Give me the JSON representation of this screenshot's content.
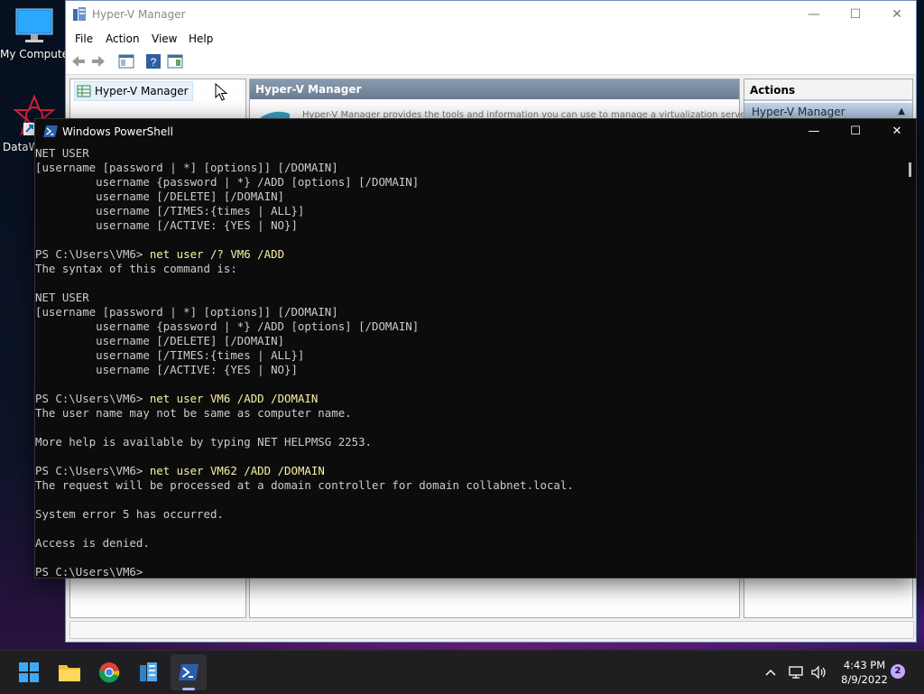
{
  "desktop": {
    "icons": [
      {
        "label": "My Computer"
      },
      {
        "label": "DataW"
      }
    ]
  },
  "hyperv": {
    "title": "Hyper-V Manager",
    "menu": [
      "File",
      "Action",
      "View",
      "Help"
    ],
    "tree_item": "Hyper-V Manager",
    "center_header": "Hyper-V Manager",
    "center_blurb": "Hyper-V Manager provides the tools and information you can use to manage a virtualization server.",
    "actions_header": "Actions",
    "actions_item": "Hyper-V Manager"
  },
  "powershell": {
    "title": "Windows PowerShell",
    "lines": [
      {
        "text": "NET USER"
      },
      {
        "text": "[username [password | *] [options]] [/DOMAIN]"
      },
      {
        "text": "         username {password | *} /ADD [options] [/DOMAIN]"
      },
      {
        "text": "         username [/DELETE] [/DOMAIN]"
      },
      {
        "text": "         username [/TIMES:{times | ALL}]"
      },
      {
        "text": "         username [/ACTIVE: {YES | NO}]"
      },
      {
        "text": ""
      },
      {
        "prompt": "PS C:\\Users\\VM6> ",
        "cmd": "net user /? VM6 /ADD"
      },
      {
        "text": "The syntax of this command is:"
      },
      {
        "text": ""
      },
      {
        "text": "NET USER"
      },
      {
        "text": "[username [password | *] [options]] [/DOMAIN]"
      },
      {
        "text": "         username {password | *} /ADD [options] [/DOMAIN]"
      },
      {
        "text": "         username [/DELETE] [/DOMAIN]"
      },
      {
        "text": "         username [/TIMES:{times | ALL}]"
      },
      {
        "text": "         username [/ACTIVE: {YES | NO}]"
      },
      {
        "text": ""
      },
      {
        "prompt": "PS C:\\Users\\VM6> ",
        "cmd": "net user VM6 /ADD /DOMAIN"
      },
      {
        "text": "The user name may not be same as computer name."
      },
      {
        "text": ""
      },
      {
        "text": "More help is available by typing NET HELPMSG 2253."
      },
      {
        "text": ""
      },
      {
        "prompt": "PS C:\\Users\\VM6> ",
        "cmd": "net user VM62 /ADD /DOMAIN"
      },
      {
        "text": "The request will be processed at a domain controller for domain collabnet.local."
      },
      {
        "text": ""
      },
      {
        "text": "System error 5 has occurred."
      },
      {
        "text": ""
      },
      {
        "text": "Access is denied."
      },
      {
        "text": ""
      },
      {
        "prompt": "PS C:\\Users\\VM6> ",
        "cmd": ""
      }
    ]
  },
  "taskbar": {
    "time": "4:43 PM",
    "date": "8/9/2022",
    "notifications": "2"
  }
}
